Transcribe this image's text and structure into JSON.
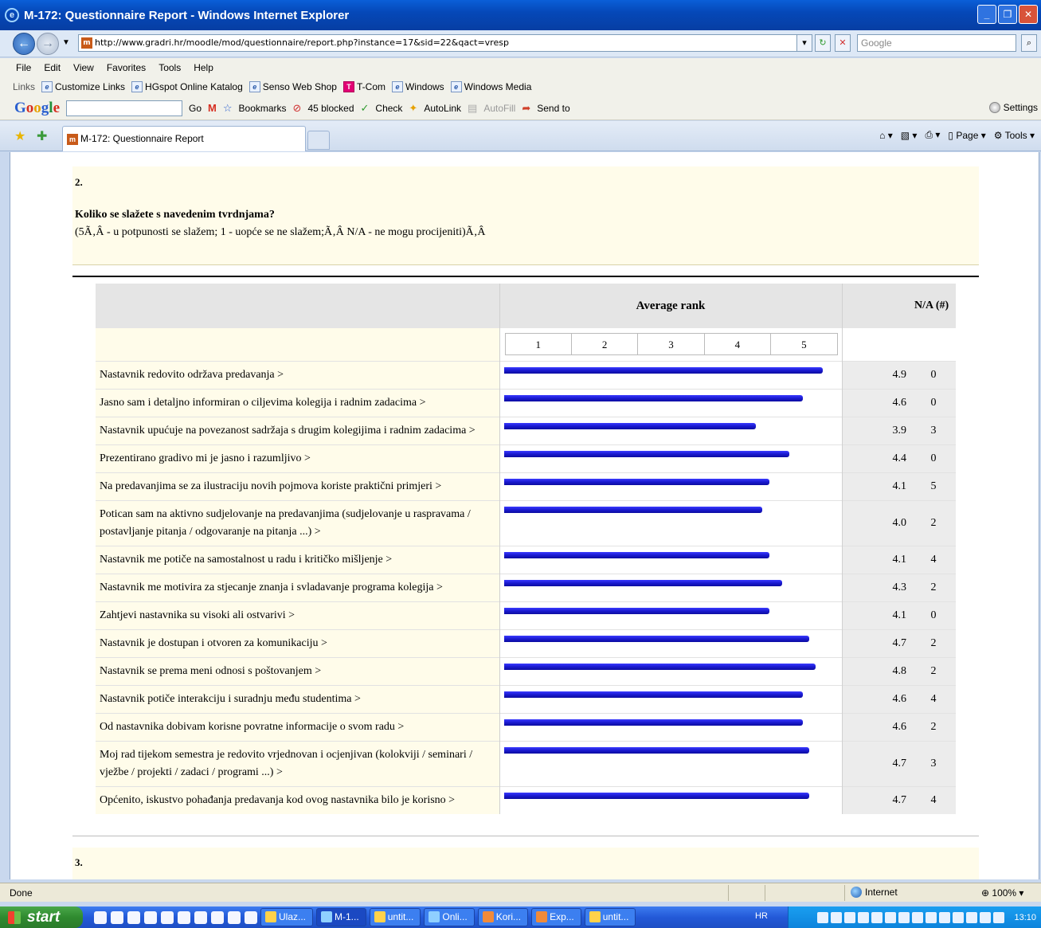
{
  "window": {
    "title": "M-172: Questionnaire Report - Windows Internet Explorer"
  },
  "address": {
    "url": "http://www.gradri.hr/moodle/mod/questionnaire/report.php?instance=17&sid=22&qact=vresp",
    "search_placeholder": "Google"
  },
  "menu": [
    "File",
    "Edit",
    "View",
    "Favorites",
    "Tools",
    "Help"
  ],
  "links_bar": {
    "label": "Links",
    "items": [
      "Customize Links",
      "HGspot Online Katalog",
      "Senso Web Shop",
      "T-Com",
      "Windows",
      "Windows Media"
    ]
  },
  "google_bar": {
    "go_label": "Go",
    "bookmarks": "Bookmarks",
    "blocked": "45 blocked",
    "check": "Check",
    "autolink": "AutoLink",
    "autofill": "AutoFill",
    "send_to": "Send to",
    "settings": "Settings"
  },
  "tab": {
    "title": "M-172: Questionnaire Report"
  },
  "command_bar": {
    "page": "Page",
    "tools": "Tools"
  },
  "question": {
    "number": "2.",
    "title": "Koliko se slažete s navedenim tvrdnjama?",
    "subtitle": "(5Ã‚Â - u potpunosti se slažem; 1 - uopće se ne slažem;Ã‚Â N/A - ne mogu procijeniti)Ã‚Â"
  },
  "next_question": {
    "number": "3."
  },
  "report_table": {
    "header_rank": "Average rank",
    "header_na": "N/A (#)",
    "scale": [
      "1",
      "2",
      "3",
      "4",
      "5"
    ],
    "scale_min": 1,
    "scale_max": 5,
    "rows": [
      {
        "label": "Nastavnik redovito održava predavanja >",
        "avg": "4.9",
        "na": "0"
      },
      {
        "label": "Jasno sam i detaljno informiran o ciljevima kolegija i radnim zadacima >",
        "avg": "4.6",
        "na": "0"
      },
      {
        "label": "Nastavnik upućuje na povezanost sadržaja s drugim kolegijima i radnim zadacima >",
        "avg": "3.9",
        "na": "3"
      },
      {
        "label": "Prezentirano gradivo mi je jasno i razumljivo >",
        "avg": "4.4",
        "na": "0"
      },
      {
        "label": "Na predavanjima se za ilustraciju novih pojmova koriste praktični primjeri >",
        "avg": "4.1",
        "na": "5"
      },
      {
        "label": "Potican sam na aktivno sudjelovanje na predavanjima (sudjelovanje u raspravama / postavljanje pitanja / odgovaranje na pitanja ...) >",
        "avg": "4.0",
        "na": "2"
      },
      {
        "label": "Nastavnik me potiče na samostalnost u radu i kritičko mišljenje >",
        "avg": "4.1",
        "na": "4"
      },
      {
        "label": "Nastavnik me motivira za stjecanje znanja i svladavanje programa kolegija >",
        "avg": "4.3",
        "na": "2"
      },
      {
        "label": "Zahtjevi nastavnika su visoki ali ostvarivi >",
        "avg": "4.1",
        "na": "0"
      },
      {
        "label": "Nastavnik je dostupan i otvoren za komunikaciju >",
        "avg": "4.7",
        "na": "2"
      },
      {
        "label": "Nastavnik se prema meni odnosi s poštovanjem >",
        "avg": "4.8",
        "na": "2"
      },
      {
        "label": "Nastavnik potiče interakciju i suradnju među studentima >",
        "avg": "4.6",
        "na": "4"
      },
      {
        "label": "Od nastavnika dobivam korisne povratne informacije o svom radu >",
        "avg": "4.6",
        "na": "2"
      },
      {
        "label": "Moj rad tijekom semestra je redovito vrjednovan i ocjenjivan (kolokviji / seminari / vježbe / projekti / zadaci / programi ...) >",
        "avg": "4.7",
        "na": "3"
      },
      {
        "label": "Općenito, iskustvo pohađanja predavanja kod ovog nastavnika bilo je korisno >",
        "avg": "4.7",
        "na": "4"
      }
    ]
  },
  "status_bar": {
    "status": "Done",
    "zone": "Internet",
    "zoom": "100%"
  },
  "taskbar": {
    "start": "start",
    "buttons": [
      "Ulaz...",
      "M-1...",
      "untit...",
      "Onli...",
      "Kori...",
      "Exp...",
      "untit..."
    ],
    "language": "HR",
    "clock": "13:10"
  },
  "colors": {
    "bar": "#1a1ad0",
    "question_bg": "#fffcea",
    "header_bg": "#e5e5e5"
  }
}
